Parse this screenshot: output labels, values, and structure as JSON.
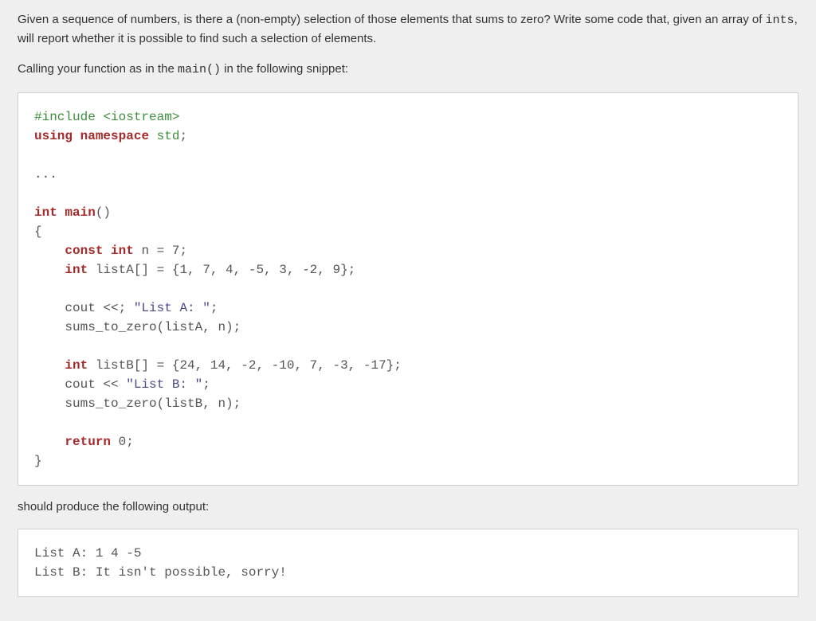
{
  "para1_part1": "Given a sequence of numbers, is there a (non-empty) selection of those elements that sums to zero? Write some code that, given an array of ",
  "para1_code": "ints",
  "para1_part2": ", will report whether it is possible to find such a selection of elements.",
  "para2_part1": "Calling your function as in the ",
  "para2_code": "main()",
  "para2_part2": " in the following snippet:",
  "code1": {
    "l1_preproc": "#include ",
    "l1_path": "<iostream>",
    "l2_kw1": "using",
    "l2_kw2": "namespace",
    "l2_ns": "std",
    "l2_punc": ";",
    "l3_dots": "...",
    "l4_type": "int",
    "l4_func": "main",
    "l4_paren": "()",
    "l5_brace": "{",
    "l6_indent": "    ",
    "l6_kw": "const",
    "l6_type": "int",
    "l6_rest": " n = 7;",
    "l7_indent": "    ",
    "l7_type": "int",
    "l7_rest": " listA[] = {1, 7, 4, -5, 3, -2, 9};",
    "l8_indent": "    cout <<; ",
    "l8_str": "\"List A: \"",
    "l8_semi": ";",
    "l9": "    sums_to_zero(listA, n);",
    "l10_indent": "    ",
    "l10_type": "int",
    "l10_rest": " listB[] = {24, 14, -2, -10, 7, -3, -17};",
    "l11_indent": "    cout << ",
    "l11_str": "\"List B: \"",
    "l11_semi": ";",
    "l12": "    sums_to_zero(listB, n);",
    "l13_indent": "    ",
    "l13_kw": "return",
    "l13_rest": " 0;",
    "l14_brace": "}"
  },
  "para3": "should produce the following output:",
  "output": {
    "line1": "List A: 1 4 -5",
    "line2": "List B: It isn't possible, sorry!"
  }
}
